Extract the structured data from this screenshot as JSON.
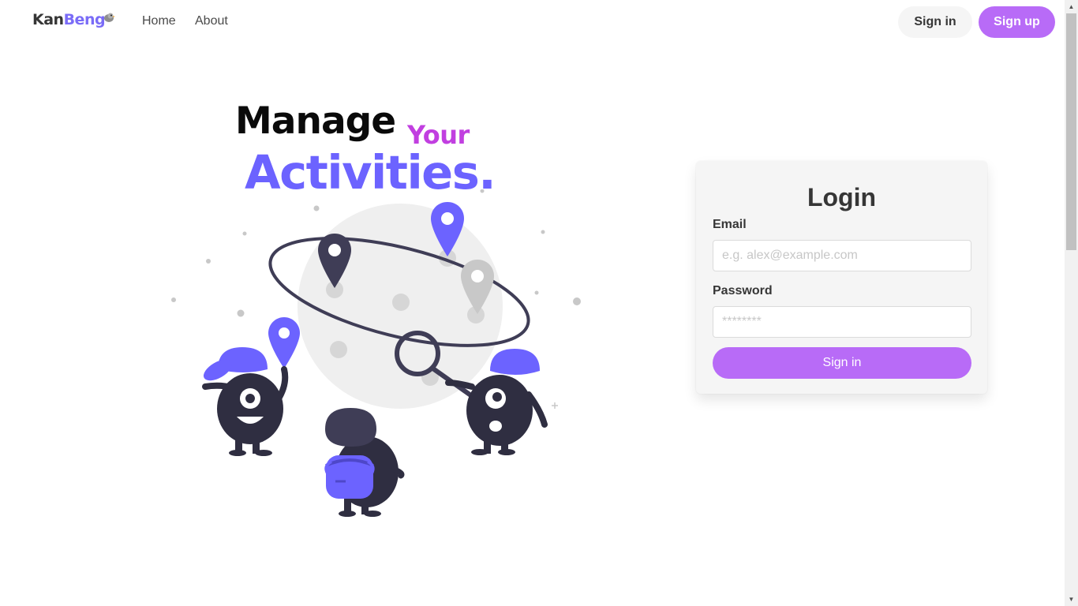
{
  "navbar": {
    "brand_part1": "Kan",
    "brand_part2": "Beng",
    "links": [
      {
        "label": "Home"
      },
      {
        "label": "About"
      }
    ],
    "signin_label": "Sign in",
    "signup_label": "Sign up"
  },
  "hero": {
    "line1": "Manage",
    "line1_accent": "Your",
    "line2": "Activities."
  },
  "login": {
    "title": "Login",
    "email_label": "Email",
    "email_placeholder": "e.g. alex@example.com",
    "email_value": "",
    "password_label": "Password",
    "password_placeholder": "********",
    "password_value": "",
    "submit_label": "Sign in"
  },
  "colors": {
    "accent": "#b86bf7",
    "brand_purple": "#6c63ff",
    "your_magenta": "#c13fe0",
    "dark": "#363636",
    "character_dark": "#2f2e41"
  },
  "icons": [
    "bird-logo-icon",
    "location-pin-icon",
    "magnifier-icon",
    "scroll-up-arrow-icon",
    "scroll-down-arrow-icon"
  ]
}
